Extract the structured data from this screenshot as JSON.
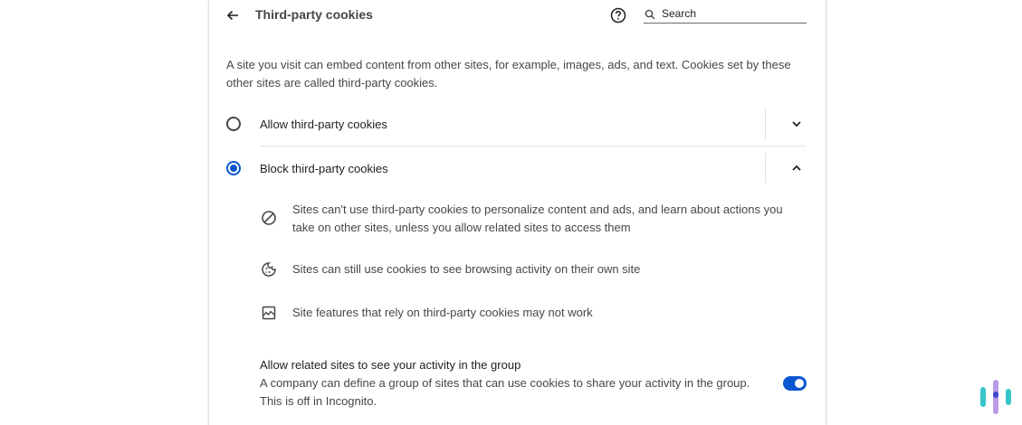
{
  "header": {
    "title": "Third-party cookies",
    "search_placeholder": "Search"
  },
  "description": "A site you visit can embed content from other sites, for example, images, ads, and text. Cookies set by these other sites are called third-party cookies.",
  "options": [
    {
      "label": "Allow third-party cookies",
      "selected": false,
      "expanded": false
    },
    {
      "label": "Block third-party cookies",
      "selected": true,
      "expanded": true
    }
  ],
  "details": [
    {
      "icon": "block-icon",
      "text": "Sites can't use third-party cookies to personalize content and ads, and learn about actions you take on other sites, unless you allow related sites to access them"
    },
    {
      "icon": "cookie-icon",
      "text": "Sites can still use cookies to see browsing activity on their own site"
    },
    {
      "icon": "broken-image-icon",
      "text": "Site features that rely on third-party cookies may not work"
    }
  ],
  "related_sites": {
    "title": "Allow related sites to see your activity in the group",
    "description": "A company can define a group of sites that can use cookies to share your activity in the group. This is off in Incognito.",
    "enabled": true
  },
  "colors": {
    "accent": "#0b57d0",
    "logo_teal": "#37c5c9",
    "logo_purple": "#b99be6",
    "logo_blue": "#3a4bd1"
  }
}
